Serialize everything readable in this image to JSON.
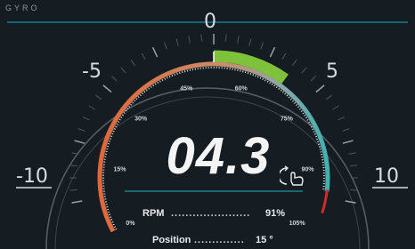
{
  "brand": "GYRO",
  "readout": {
    "value": "04.3"
  },
  "scale": {
    "zero": "0",
    "minus5": "-5",
    "plus5": "5",
    "minus10": "-10",
    "plus10": "10"
  },
  "percent_marks": [
    "0%",
    "15%",
    "30%",
    "45%",
    "60%",
    "75%",
    "90%",
    "105%"
  ],
  "info": {
    "rpm_label": "RPM",
    "rpm_dots": "......................",
    "rpm_value": "91%",
    "position_label": "Position",
    "position_dots": "..............",
    "position_value": "15 °"
  },
  "arc_fill": {
    "rpm_fraction": 0.91,
    "position_fraction": 0.43
  },
  "colors": {
    "background": "#161d22",
    "rpm_low": "#e0673a",
    "rpm_high": "#3fb1b0",
    "position_green": "#7dc23a",
    "position_red": "#d42a2a",
    "accent_line": "#0e7f8c"
  },
  "icons": [
    "gyro-control-icon"
  ]
}
